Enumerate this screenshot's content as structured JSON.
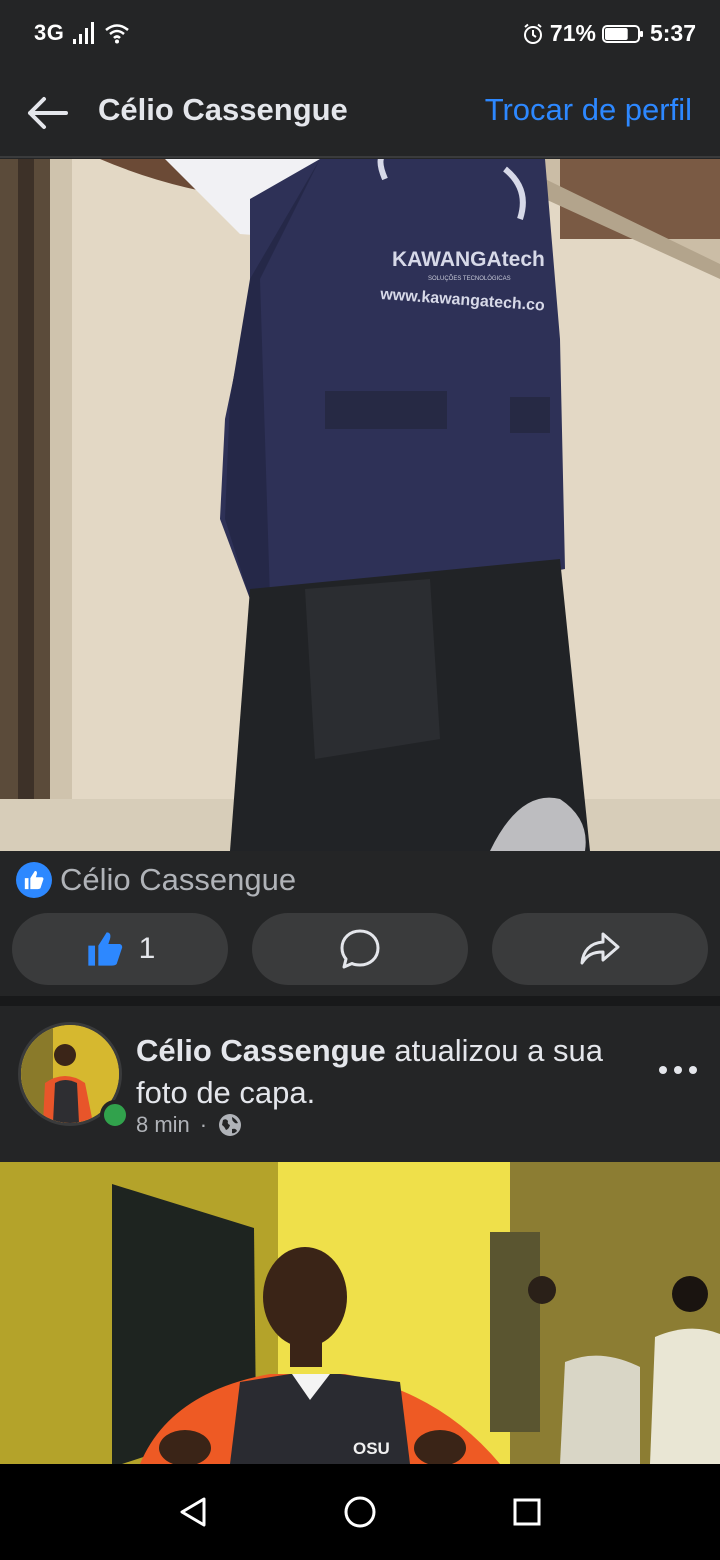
{
  "status_bar": {
    "network": "3G",
    "battery_percent": "71%",
    "battery_level": 0.71,
    "time": "5:37"
  },
  "header": {
    "back_icon": "arrow-left-icon",
    "title": "Célio Cassengue",
    "switch_profile": "Trocar de perfil"
  },
  "photo_post": {
    "image_text": {
      "brand": "KAWANGAtech",
      "tagline": "SOLUÇÕES TECNOLÓGICAS",
      "website": "www.kawangatech.co"
    },
    "reactor_name": "Célio Cassengue",
    "like_count": "1",
    "actions": {
      "like_icon": "thumbs-up-icon",
      "comment_icon": "comment-bubble-icon",
      "share_icon": "share-arrow-icon"
    }
  },
  "cover_post": {
    "author": "Célio Cassengue",
    "action_text": " atualizou a sua foto de capa.",
    "time": "8 min",
    "separator": "·",
    "privacy_icon": "globe-icon",
    "more_icon": "more-dots-icon",
    "image_text": {
      "shirt_logo": "OSU"
    }
  },
  "nav_bar": {
    "back_icon": "triangle-back-icon",
    "home_icon": "circle-home-icon",
    "recents_icon": "square-recents-icon"
  },
  "colors": {
    "background": "#242526",
    "accent": "#2d88ff",
    "button_bg": "#3a3b3c",
    "online": "#31a24c"
  }
}
